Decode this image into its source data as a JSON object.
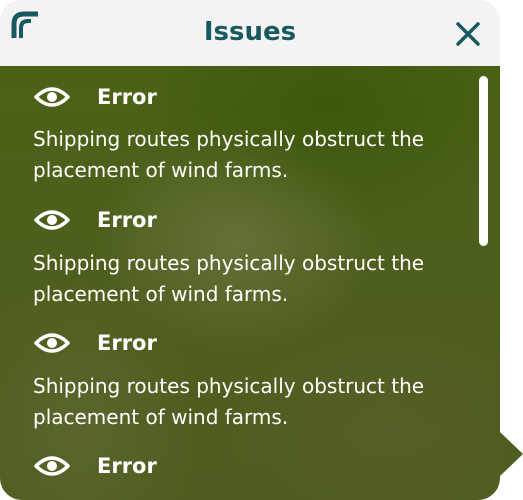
{
  "header": {
    "title": "Issues",
    "logo_icon": "corner-logo-icon",
    "close_icon": "close-icon"
  },
  "issues": [
    {
      "label": "Error",
      "text": "Shipping routes physically obstruct the placement of wind farms.",
      "icon": "eye-icon"
    },
    {
      "label": "Error",
      "text": "Shipping routes physically obstruct the placement of wind farms.",
      "icon": "eye-icon"
    },
    {
      "label": "Error",
      "text": "Shipping routes physically obstruct the placement of wind farms.",
      "icon": "eye-icon"
    },
    {
      "label": "Error",
      "icon": "eye-icon"
    }
  ],
  "colors": {
    "header_bg": "#f3f3f3",
    "title": "#17595f",
    "body_bg": "#4d5f1c",
    "text": "#ffffff"
  }
}
